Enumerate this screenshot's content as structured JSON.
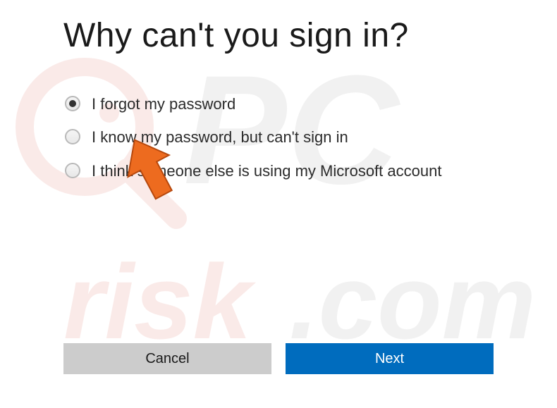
{
  "dialog": {
    "title": "Why can't you sign in?",
    "options": [
      {
        "label": "I forgot my password",
        "selected": true
      },
      {
        "label": "I know my password, but can't sign in",
        "selected": false
      },
      {
        "label": "I think someone else is using my Microsoft account",
        "selected": false
      }
    ],
    "buttons": {
      "cancel": "Cancel",
      "next": "Next"
    }
  },
  "watermark": {
    "text_top": "PC",
    "text_bottom": "risk.com"
  },
  "colors": {
    "primary": "#006cbe",
    "secondary": "#cccccc",
    "cursor": "#ed6b1f"
  }
}
